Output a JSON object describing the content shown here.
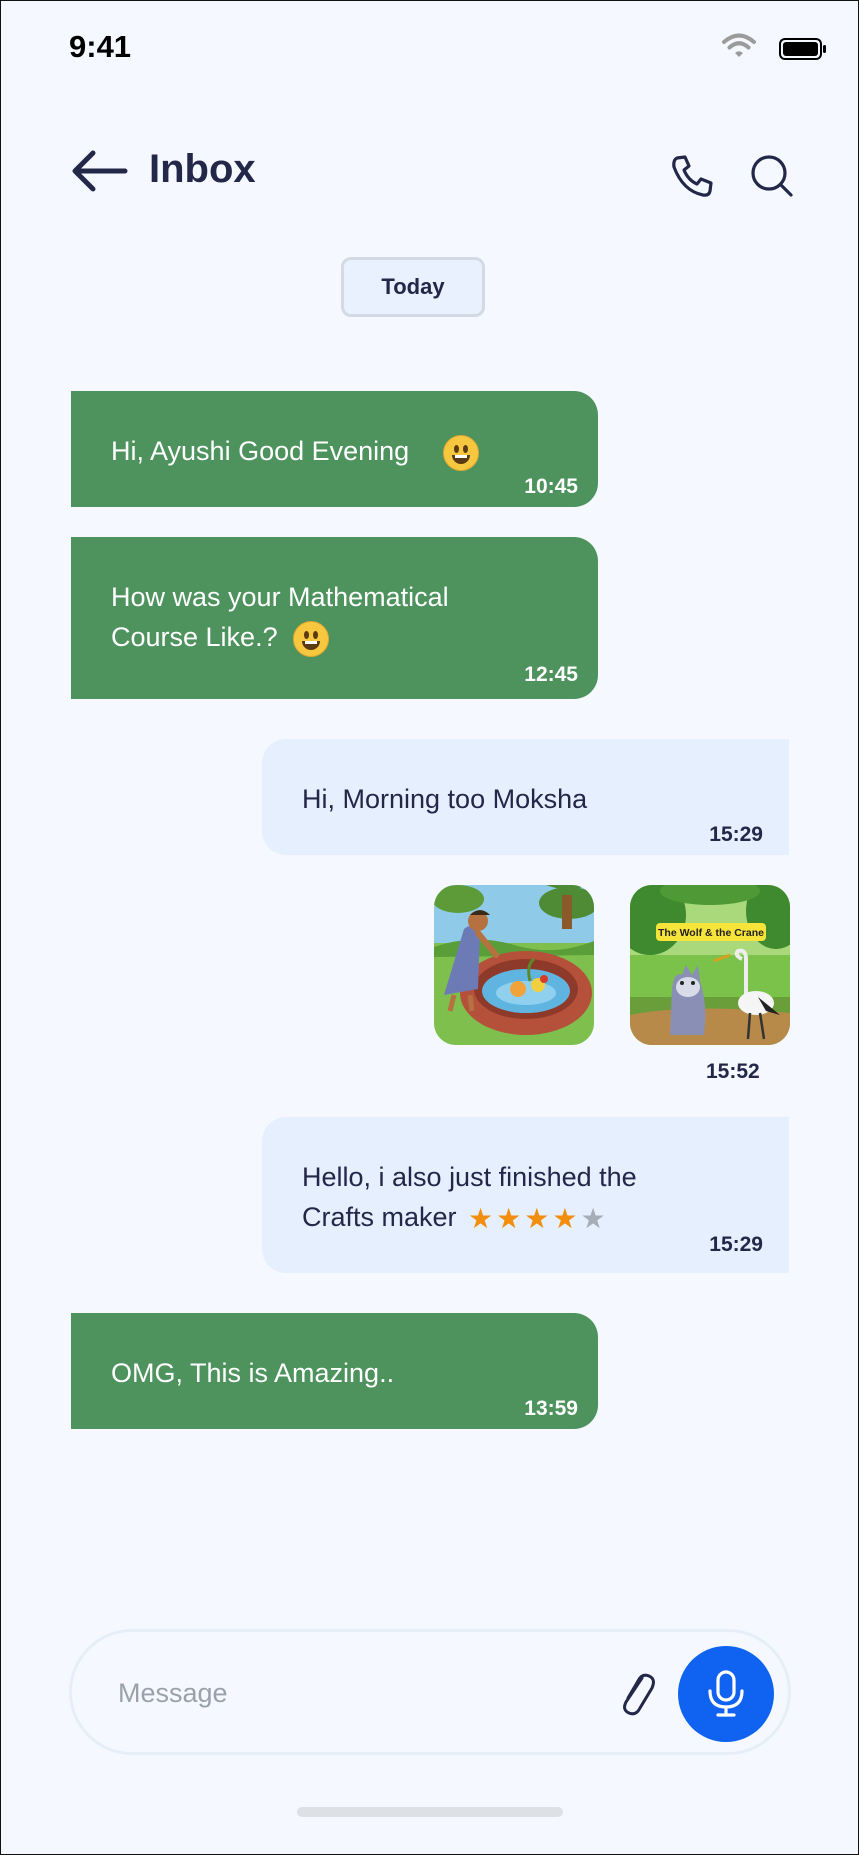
{
  "status_bar": {
    "time": "9:41"
  },
  "header": {
    "title": "Inbox"
  },
  "date_separator": "Today",
  "messages": [
    {
      "text": "Hi, Ayushi Good Evening",
      "time": "10:45"
    },
    {
      "line1": "How was your Mathematical",
      "line2": "Course Like.?",
      "time": "12:45"
    },
    {
      "text": "Hi, Morning too Moksha",
      "time": "15:29"
    },
    {
      "image_names": [
        "well-rescue-illustration",
        "wolf-and-crane-illustration"
      ],
      "image_title": "The Wolf & the Crane",
      "time": "15:52"
    },
    {
      "line1": "Hello, i also just finished the",
      "line2": "Crafts maker",
      "rating": 4,
      "rating_max": 5,
      "time": "15:29"
    },
    {
      "text": "OMG, This is Amazing..",
      "time": "13:59"
    }
  ],
  "composer": {
    "placeholder": "Message"
  },
  "colors": {
    "incoming_bubble": "#4e935e",
    "outgoing_bubble": "#e5effd",
    "accent": "#0f63f0",
    "background": "#f5f9ff"
  },
  "icons": [
    "back-arrow-icon",
    "phone-icon",
    "search-icon",
    "wifi-icon",
    "battery-icon",
    "smile-emoji-icon",
    "star-icon",
    "paperclip-icon",
    "microphone-icon"
  ]
}
